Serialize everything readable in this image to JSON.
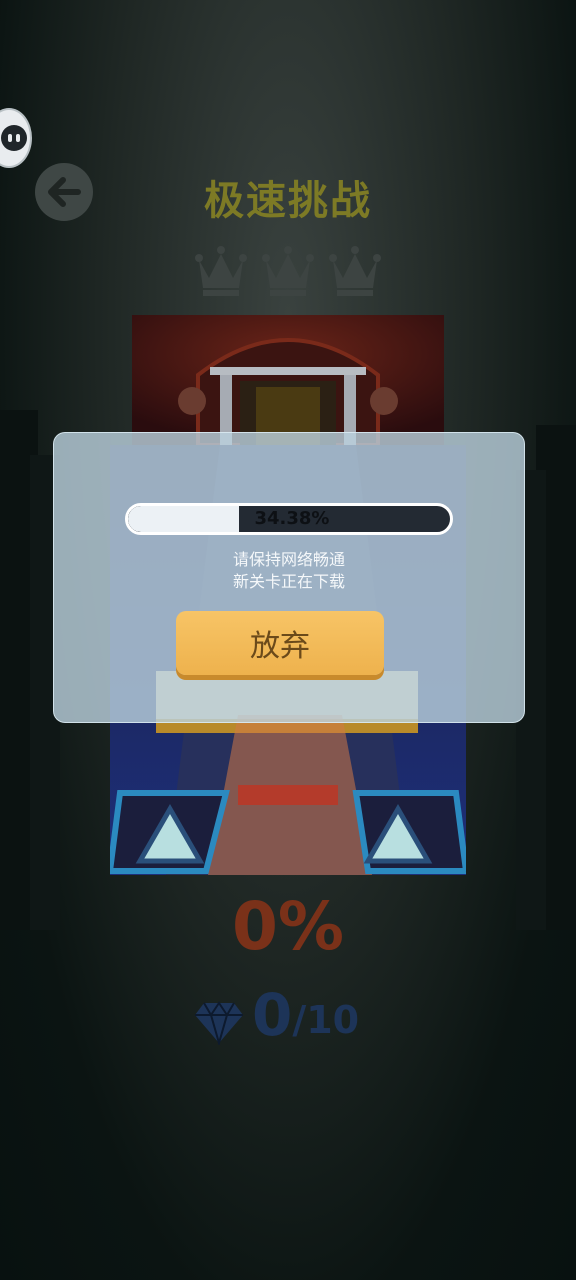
{
  "header": {
    "title": "极速挑战",
    "crowns_earned": 0,
    "crowns_total": 3
  },
  "level": {
    "progress_percent": "0%",
    "gems_collected": "0",
    "gems_total": "/10"
  },
  "download_dialog": {
    "progress_value": 0.3438,
    "progress_text": "34.38%",
    "message_line1": "请保持网络畅通",
    "message_line2": "新关卡正在下载",
    "giveup_label": "放弃"
  },
  "icons": {
    "back": "arrow-left-icon",
    "avatar": "robot-face-icon",
    "crown": "crown-icon",
    "gem": "diamond-icon"
  },
  "colors": {
    "title": "#7d7a25",
    "percent": "#7a3119",
    "gems": "#1d3458",
    "button": "#f2b955"
  }
}
